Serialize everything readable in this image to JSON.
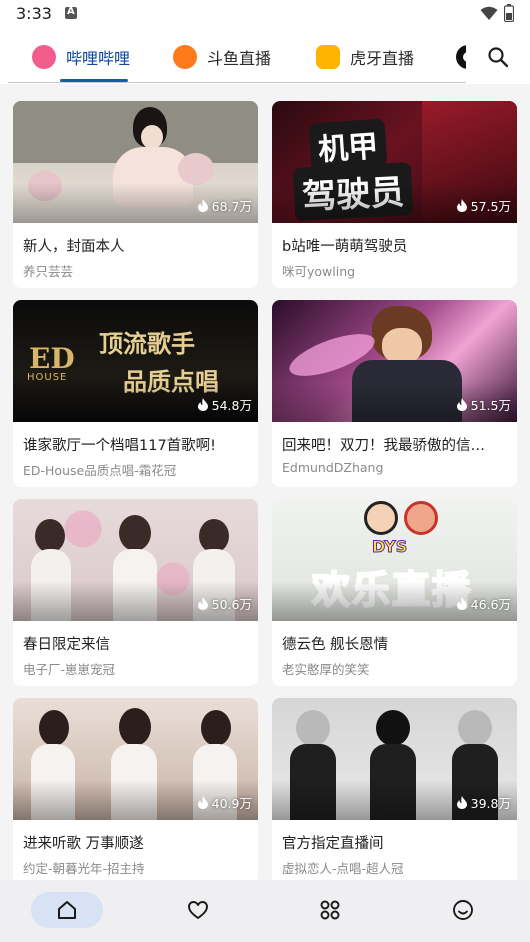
{
  "status_bar": {
    "time": "3:33"
  },
  "tabs": [
    {
      "label": "哔哩哔哩",
      "icon": "bilibili-logo-icon",
      "selected": true
    },
    {
      "label": "斗鱼直播",
      "icon": "douyu-logo-icon",
      "selected": false
    },
    {
      "label": "虎牙直播",
      "icon": "huya-logo-icon",
      "selected": false
    },
    {
      "label": "",
      "icon": "platform-logo-icon",
      "selected": false
    }
  ],
  "search": {
    "icon": "search-icon"
  },
  "rooms": [
    {
      "title": "新人，封面本人",
      "streamer": "养只芸芸",
      "viewers": "68.7万"
    },
    {
      "title": "b站唯一萌萌驾驶员",
      "streamer": "咪可yowling",
      "viewers": "57.5万",
      "cover_text": [
        "机甲",
        "驾驶员"
      ]
    },
    {
      "title": "谁家歌厅一个档唱117首歌啊!",
      "streamer": "ED-House品质点唱-霜花冠",
      "viewers": "54.8万",
      "cover_text": [
        "ED",
        "HOUSE",
        "顶流歌手",
        "品质点唱"
      ]
    },
    {
      "title": "回来吧！双刀！我最骄傲的信…",
      "streamer": "EdmundDZhang",
      "viewers": "51.5万"
    },
    {
      "title": "春日限定来信",
      "streamer": "电子厂-崽崽宠冠",
      "viewers": "50.6万"
    },
    {
      "title": "德云色 舰长恩情",
      "streamer": "老实憨厚的笑笑",
      "viewers": "46.6万",
      "cover_text": [
        "DYS",
        "欢乐直播"
      ]
    },
    {
      "title": "进来听歌 万事顺遂",
      "streamer": "约定-朝暮光年-招主持",
      "viewers": "40.9万"
    },
    {
      "title": "官方指定直播间",
      "streamer": "虚拟恋人-点唱-超人冠",
      "viewers": "39.8万"
    }
  ],
  "bottom_nav": [
    {
      "icon": "home-icon",
      "selected": true
    },
    {
      "icon": "heart-icon",
      "selected": false
    },
    {
      "icon": "categories-icon",
      "selected": false
    },
    {
      "icon": "profile-smiley-icon",
      "selected": false
    }
  ],
  "colors": {
    "accent": "#1e5aa8",
    "nav_selected_bg": "#d7e3f4",
    "background": "#f4f4f4"
  }
}
